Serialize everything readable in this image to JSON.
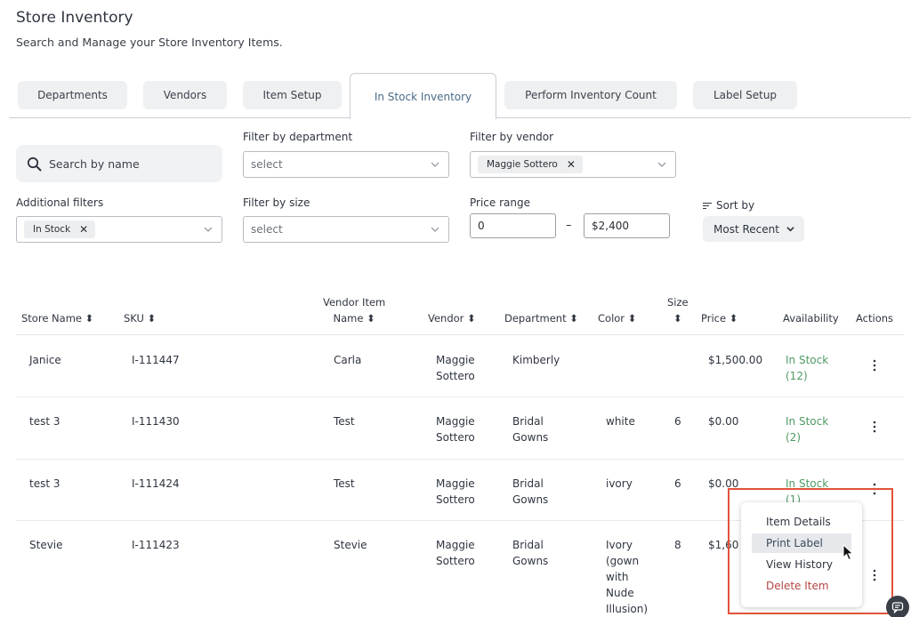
{
  "header": {
    "title": "Store Inventory",
    "subtitle": "Search and Manage your Store Inventory Items."
  },
  "tabs": [
    {
      "label": "Departments"
    },
    {
      "label": "Vendors"
    },
    {
      "label": "Item Setup"
    },
    {
      "label": "In Stock Inventory",
      "active": true
    },
    {
      "label": "Perform Inventory Count"
    },
    {
      "label": "Label Setup"
    }
  ],
  "filters": {
    "search_placeholder": "Search by name",
    "department_label": "Filter by department",
    "department_value": "select",
    "vendor_label": "Filter by vendor",
    "vendor_chip": "Maggie Sottero",
    "additional_label": "Additional filters",
    "additional_chip": "In Stock",
    "size_label": "Filter by size",
    "size_value": "select",
    "price_label": "Price range",
    "price_min": "0",
    "price_max": "$2,400",
    "price_dash": "–",
    "sort_label": "Sort by",
    "sort_value": "Most Recent"
  },
  "table": {
    "headers": {
      "store_name": "Store Name",
      "sku": "SKU",
      "vendor_item_line1": "Vendor Item",
      "vendor_item_line2": "Name",
      "vendor": "Vendor",
      "department": "Department",
      "color": "Color",
      "size_line1": "Size",
      "price": "Price",
      "availability": "Availability",
      "actions": "Actions"
    },
    "rows": [
      {
        "store": "Janice",
        "sku": "I-111447",
        "item": "Carla",
        "vendor1": "Maggie",
        "vendor2": "Sottero",
        "dept1": "Kimberly",
        "dept2": "",
        "color": [
          "",
          "",
          "",
          "",
          ""
        ],
        "size": "",
        "price": "$1,500.00",
        "avail1": "In Stock",
        "avail2": "(12)"
      },
      {
        "store": "test 3",
        "sku": "I-111430",
        "item": "Test",
        "vendor1": "Maggie",
        "vendor2": "Sottero",
        "dept1": "Bridal",
        "dept2": "Gowns",
        "color": [
          "white",
          "",
          "",
          "",
          ""
        ],
        "size": "6",
        "price": "$0.00",
        "avail1": "In Stock",
        "avail2": "(2)"
      },
      {
        "store": "test 3",
        "sku": "I-111424",
        "item": "Test",
        "vendor1": "Maggie",
        "vendor2": "Sottero",
        "dept1": "Bridal",
        "dept2": "Gowns",
        "color": [
          "ivory",
          "",
          "",
          "",
          ""
        ],
        "size": "6",
        "price": "$0.00",
        "avail1": "In Stock",
        "avail2": "(1)"
      },
      {
        "store": "Stevie",
        "sku": "I-111423",
        "item": "Stevie",
        "vendor1": "Maggie",
        "vendor2": "Sottero",
        "dept1": "Bridal",
        "dept2": "Gowns",
        "color": [
          "Ivory",
          "(gown",
          "with",
          "Nude",
          "Illusion)"
        ],
        "size": "8",
        "price": "$1,60",
        "avail1": "",
        "avail2": ""
      }
    ]
  },
  "actions_menu": {
    "items": [
      "Item Details",
      "Print Label",
      "View History",
      "Delete Item"
    ],
    "hovered_index": 1
  },
  "icons": {
    "search": "search-icon",
    "chevron": "chevron-down-icon",
    "sort": "sort-icon",
    "kebab": "kebab-menu-icon",
    "close": "close-icon",
    "cursor": "mouse-cursor-icon",
    "chat": "chat-icon"
  },
  "colors": {
    "in_stock": "#4e9a63",
    "delete": "#b34545",
    "active_tab_text": "#4a6a88",
    "highlight_box": "#e2523a"
  }
}
